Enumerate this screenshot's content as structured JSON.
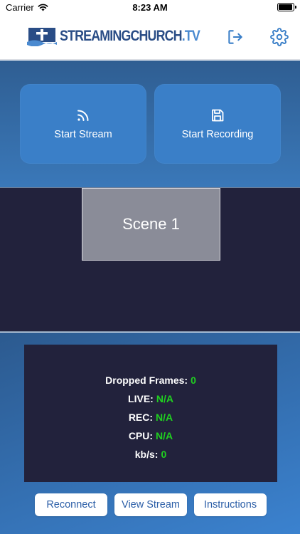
{
  "status_bar": {
    "carrier": "Carrier",
    "time": "8:23 AM",
    "battery_level": 0.95
  },
  "header": {
    "logo_text_bold": "STREAMINGCHURCH",
    "logo_text_suffix": ".TV",
    "logout_icon": "logout-icon",
    "settings_icon": "gear-icon"
  },
  "actions": {
    "start_stream": {
      "label": "Start Stream",
      "icon": "rss-feed-icon"
    },
    "start_recording": {
      "label": "Start Recording",
      "icon": "floppy-disk-icon"
    }
  },
  "scene": {
    "label": "Scene 1"
  },
  "stats": {
    "dropped_frames_label": "Dropped Frames:",
    "dropped_frames_value": "0",
    "live_label": "LIVE:",
    "live_value": "N/A",
    "rec_label": "REC:",
    "rec_value": "N/A",
    "cpu_label": "CPU:",
    "cpu_value": "N/A",
    "kbs_label": "kb/s:",
    "kbs_value": "0"
  },
  "bottom_buttons": {
    "reconnect": "Reconnect",
    "view_stream": "View Stream",
    "instructions": "Instructions"
  },
  "colors": {
    "accent": "#3a7fc8",
    "dark_panel": "#22223c",
    "stat_value": "#20d020",
    "logo": "#2a4d86"
  }
}
